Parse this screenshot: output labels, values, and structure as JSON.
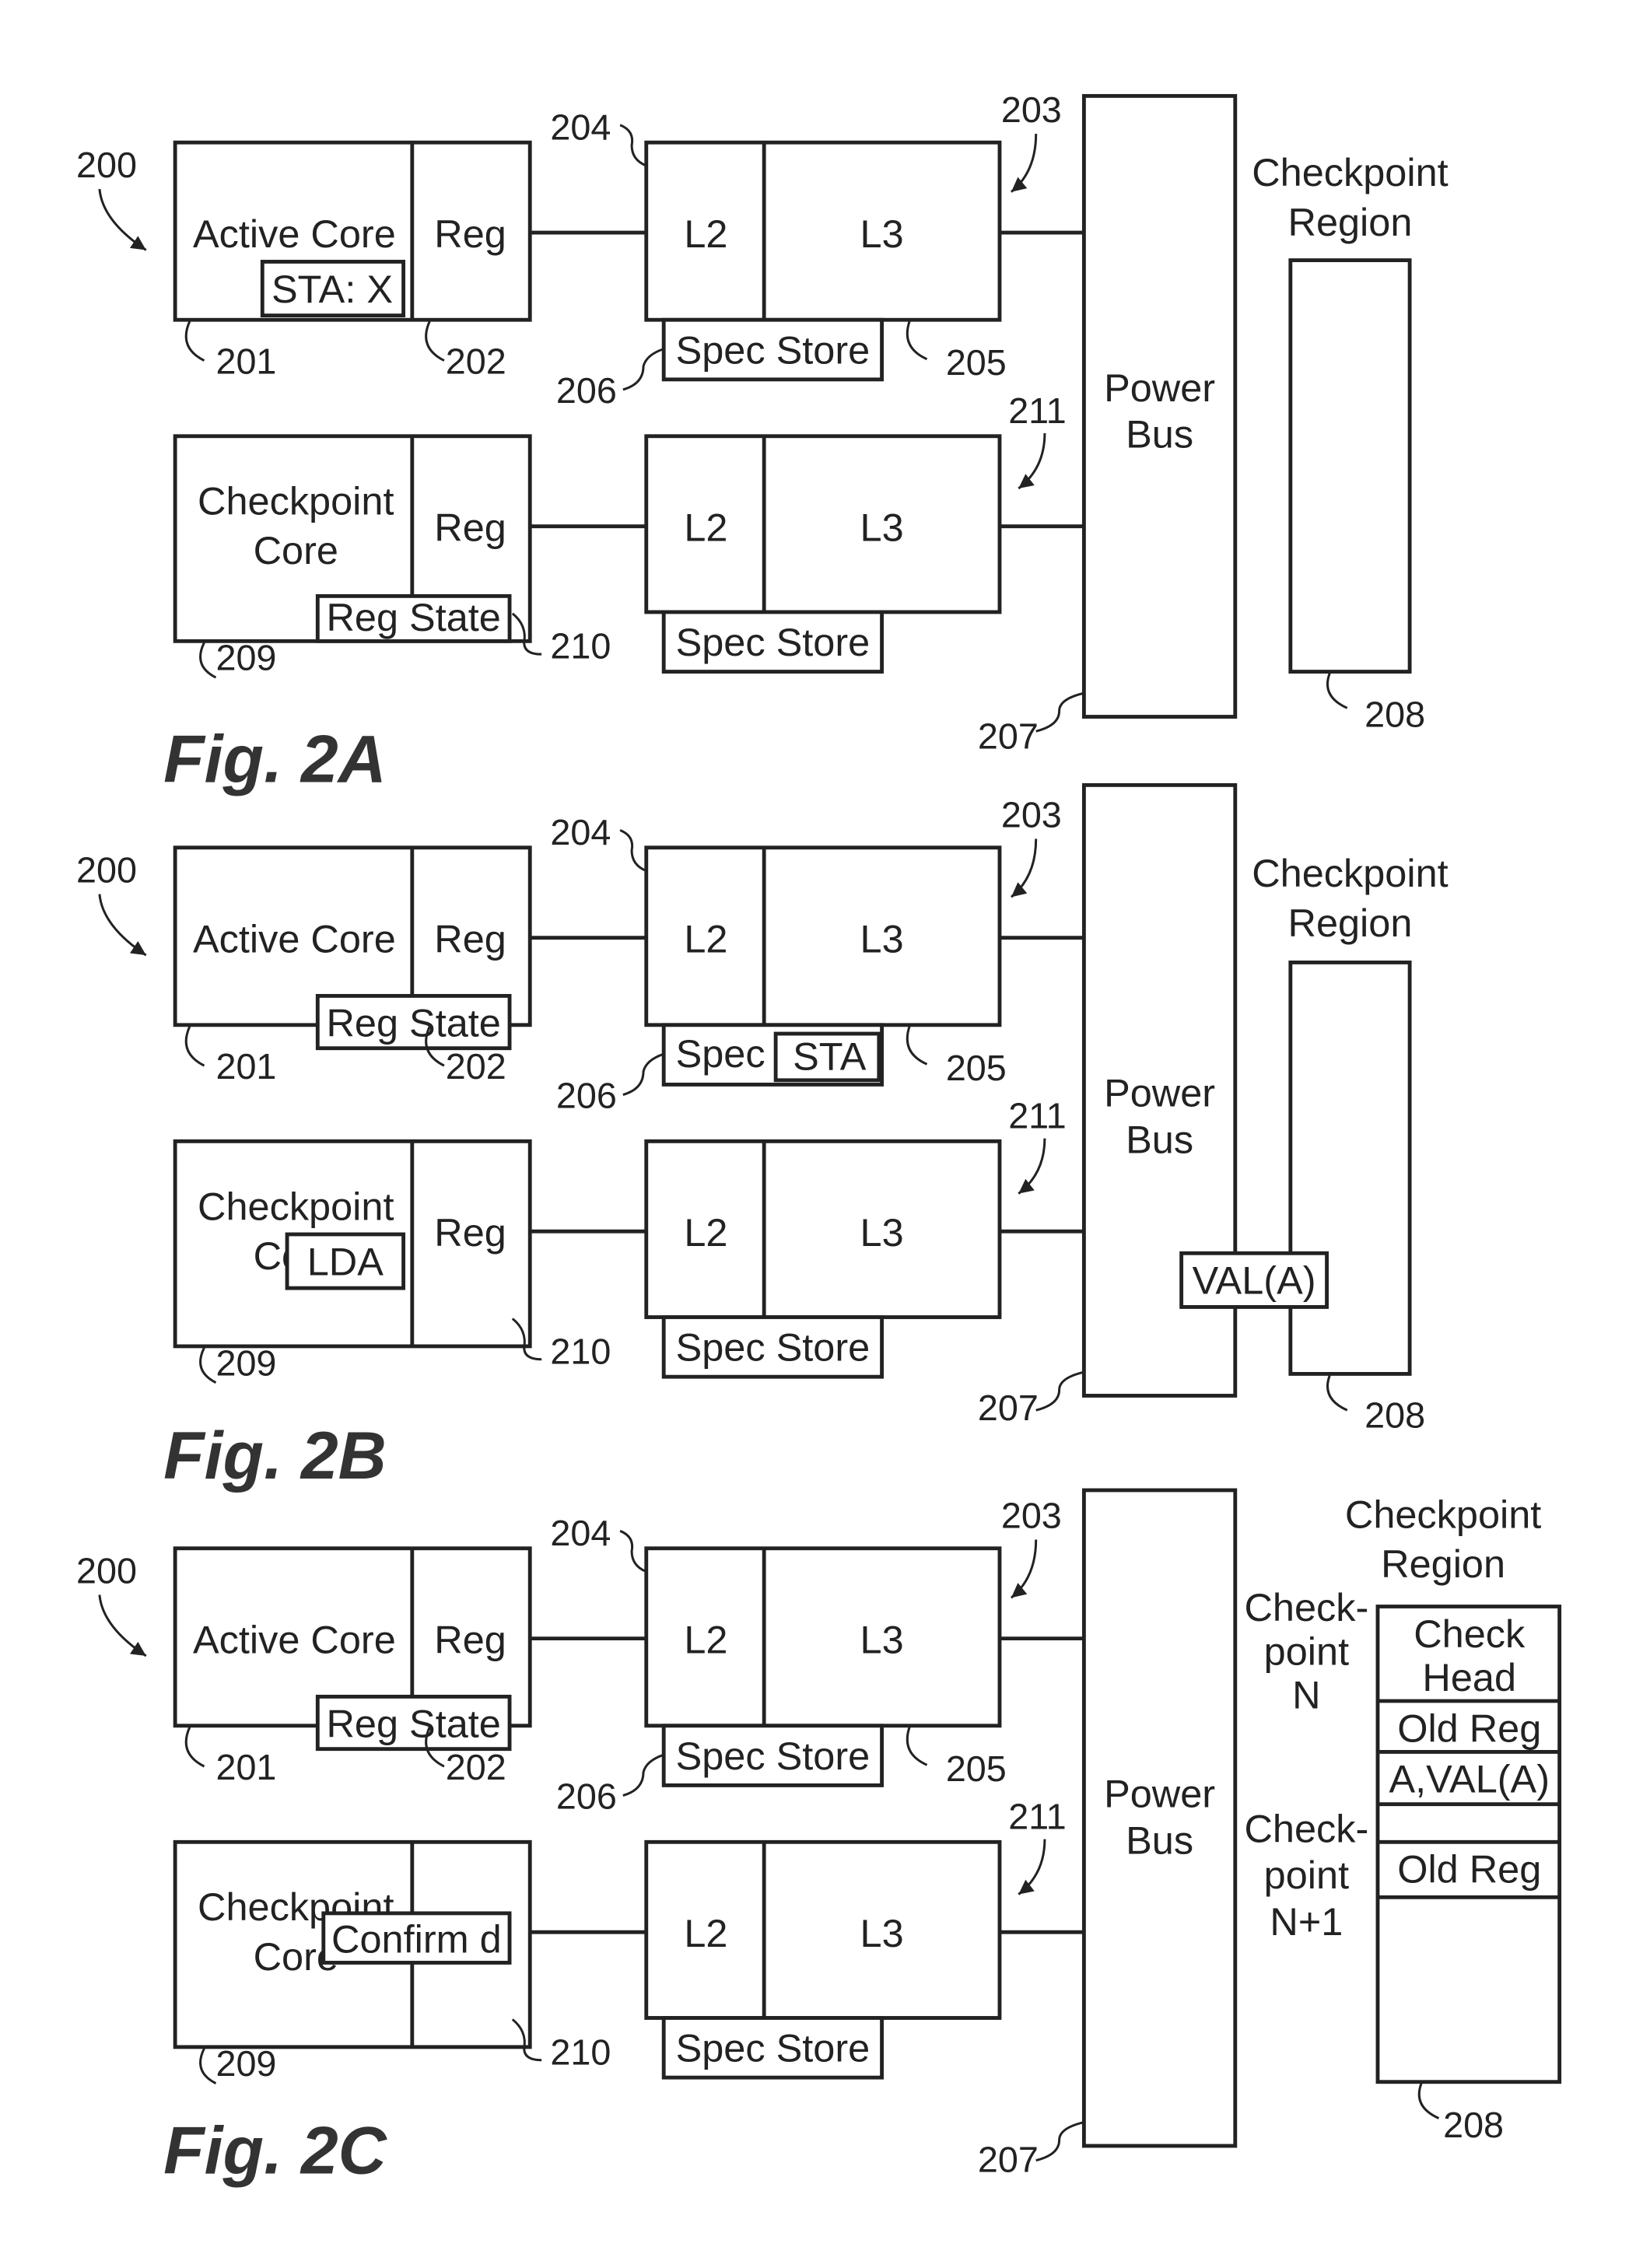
{
  "figures": [
    {
      "id": "2A",
      "caption": "Fig. 2A",
      "ref_system": "200",
      "active_core": {
        "label": "Active Core",
        "ref": "201",
        "inner_box": "STA: X"
      },
      "active_reg": {
        "label": "Reg",
        "ref": "202"
      },
      "cache_top": {
        "l2": "L2",
        "l3": "L3",
        "ref_l2": "204",
        "ref_l3": "205",
        "ref_cache": "203",
        "spec": "Spec Store",
        "spec_extra": "",
        "ref_spec": "206"
      },
      "checkpoint_core": {
        "label_line1": "Checkpoint",
        "label_line2": "Core",
        "ref": "209",
        "inner_box": ""
      },
      "checkpoint_reg": {
        "label": "Reg",
        "ref": "210",
        "inner_box": "Reg State"
      },
      "cache_bottom": {
        "l2": "L2",
        "l3": "L3",
        "ref_cache": "211",
        "spec": "Spec Store"
      },
      "power_bus": {
        "line1": "Power",
        "line2": "Bus",
        "ref": "207",
        "overlay": ""
      },
      "checkpoint_region": {
        "line1": "Checkpoint",
        "line2": "Region",
        "ref": "208"
      }
    },
    {
      "id": "2B",
      "caption": "Fig. 2B",
      "ref_system": "200",
      "active_core": {
        "label": "Active Core",
        "ref": "201",
        "inner_box": "Reg State"
      },
      "active_reg": {
        "label": "Reg",
        "ref": "202"
      },
      "cache_top": {
        "l2": "L2",
        "l3": "L3",
        "ref_l2": "204",
        "ref_l3": "205",
        "ref_cache": "203",
        "spec": "Spec",
        "spec_extra": "STA",
        "ref_spec": "206"
      },
      "checkpoint_core": {
        "label_line1": "Checkpoint",
        "label_line2": "Core",
        "ref": "209",
        "inner_box": "LDA"
      },
      "checkpoint_reg": {
        "label": "Reg",
        "ref": "210",
        "inner_box": ""
      },
      "cache_bottom": {
        "l2": "L2",
        "l3": "L3",
        "ref_cache": "211",
        "spec": "Spec Store"
      },
      "power_bus": {
        "line1": "Power",
        "line2": "Bus",
        "ref": "207",
        "overlay": "VAL(A)"
      },
      "checkpoint_region": {
        "line1": "Checkpoint",
        "line2": "Region",
        "ref": "208"
      }
    },
    {
      "id": "2C",
      "caption": "Fig. 2C",
      "ref_system": "200",
      "active_core": {
        "label": "Active Core",
        "ref": "201",
        "inner_box": "Reg State"
      },
      "active_reg": {
        "label": "Reg",
        "ref": "202"
      },
      "cache_top": {
        "l2": "L2",
        "l3": "L3",
        "ref_l2": "204",
        "ref_l3": "205",
        "ref_cache": "203",
        "spec": "Spec Store",
        "spec_extra": "",
        "ref_spec": "206"
      },
      "checkpoint_core": {
        "label_line1": "Checkpoint",
        "label_line2": "Core",
        "ref": "209",
        "inner_box": ""
      },
      "checkpoint_reg": {
        "label": "Reg",
        "ref": "210",
        "inner_box": "Confirm d"
      },
      "cache_bottom": {
        "l2": "L2",
        "l3": "L3",
        "ref_cache": "211",
        "spec": "Spec Store"
      },
      "power_bus": {
        "line1": "Power",
        "line2": "Bus",
        "ref": "207",
        "overlay": ""
      },
      "checkpoint_region": {
        "line1": "Checkpoint",
        "line2": "Region",
        "ref": "208",
        "checkpoint_n": [
          "Check-",
          "point",
          "N"
        ],
        "checkpoint_n1": [
          "Check-",
          "point",
          "N+1"
        ],
        "entries": [
          [
            "Check",
            "Head"
          ],
          [
            "Old Reg"
          ],
          [
            "A,VAL(A)"
          ],
          [
            ""
          ],
          [
            "Old Reg"
          ],
          [
            ""
          ]
        ]
      }
    }
  ]
}
